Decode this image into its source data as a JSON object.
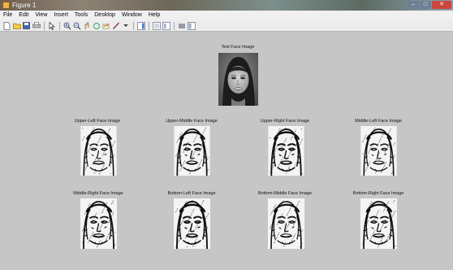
{
  "window": {
    "title": "Figure 1"
  },
  "menubar": {
    "items": [
      "File",
      "Edit",
      "View",
      "Insert",
      "Tools",
      "Desktop",
      "Window",
      "Help"
    ]
  },
  "toolbar": {
    "buttons": [
      "new-file-icon",
      "open-folder-icon",
      "save-icon",
      "print-icon",
      "pointer-icon",
      "zoom-in-icon",
      "zoom-out-icon",
      "pan-icon",
      "rotate-3d-icon",
      "data-cursor-icon",
      "brush-icon",
      "link-plot-icon",
      "insert-colorbar-icon",
      "insert-legend-icon",
      "hide-plot-tools-icon",
      "show-plot-tools-icon"
    ]
  },
  "figure": {
    "test_title": "Test Face Image",
    "row1": [
      "Upper-Left Face Image",
      "Upper-Middle Face Image",
      "Upper-Right Face Image",
      "Middle-Left Face Image"
    ],
    "row2": [
      "Middle-Right Face Image",
      "Bottom-Left Face Image",
      "Bottom-Middle Face Image",
      "Bottom-Right Face Image"
    ]
  }
}
